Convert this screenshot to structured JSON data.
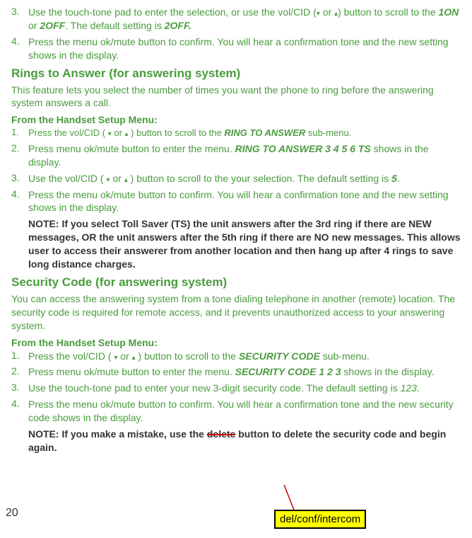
{
  "section1": {
    "items": [
      {
        "num": "3.",
        "pre": "Use the touch-tone pad to enter the selection, or use the vol/CID (",
        "mid1": " or ",
        "post1": ") button to scroll to the ",
        "opt1": "1ON",
        "or": " or ",
        "opt2": "2OFF",
        "post2": ". The default setting is ",
        "default": "2OFF."
      },
      {
        "num": "4.",
        "text": "Press the menu ok/mute button to confirm. You will hear a confirmation tone and the new setting shows in the display."
      }
    ]
  },
  "rings": {
    "heading": "Rings to Answer (for answering system)",
    "intro": "This feature lets you select the number of times you want the phone to ring before the answering system answers a call.",
    "subheading": "From the Handset Setup Menu:",
    "items": [
      {
        "num": "1.",
        "pre": "Press the vol/CID ( ",
        "mid": " or ",
        "post1": " ) button to scroll to the ",
        "bold": "RING  TO  ANSWER",
        "post2": " sub-menu."
      },
      {
        "num": "2.",
        "pre": "Press menu ok/mute button to enter the menu. ",
        "bold": "RING  TO ANSWER 3 4 5 6 TS",
        "post": " shows in the display."
      },
      {
        "num": "3.",
        "pre": "Use the vol/CID ( ",
        "mid": " or ",
        "post1": " ) button to scroll to the your selection. The default setting is ",
        "bold": "5",
        "post2": "."
      },
      {
        "num": "4.",
        "text": "Press the menu ok/mute button to confirm. You will hear a confirmation tone and the new setting shows in the display."
      }
    ],
    "note": "NOTE: If you select Toll Saver (TS) the unit answers after the 3rd ring if there are NEW messages, OR the unit answers after the 5th ring if there are NO new messages. This allows user to access their answerer from another location and then hang up after 4 rings to save long distance charges."
  },
  "security": {
    "heading": "Security Code (for answering system)",
    "intro": "You can access the answering system from a tone dialing telephone in another (remote) location. The security code is required for remote access, and it prevents unauthorized access to your answering system.",
    "subheading": "From the Handset Setup Menu:",
    "items": [
      {
        "num": "1.",
        "pre": "Press the vol/CID ( ",
        "mid": " or ",
        "post1": " ) button to scroll to the ",
        "bold": "SECURITY CODE",
        "post2": " sub-menu."
      },
      {
        "num": "2.",
        "pre": "Press menu ok/mute button to enter the menu. ",
        "bold": "SECURITY CODE 1 2 3",
        "post": " shows in the display."
      },
      {
        "num": "3.",
        "pre": "Use the touch-tone pad to enter your new 3-digit security code. The default setting is ",
        "italic": "123",
        "post": "."
      },
      {
        "num": "4.",
        "text": "Press the menu ok/mute button to confirm. You will hear a confirmation tone and the new security code shows in the display."
      }
    ],
    "note_pre": "NOTE: If you make a mistake, use the ",
    "note_strike": "delete",
    "note_post": " button to delete the security code and begin again."
  },
  "callout": "del/conf/intercom",
  "pagenum": "20"
}
